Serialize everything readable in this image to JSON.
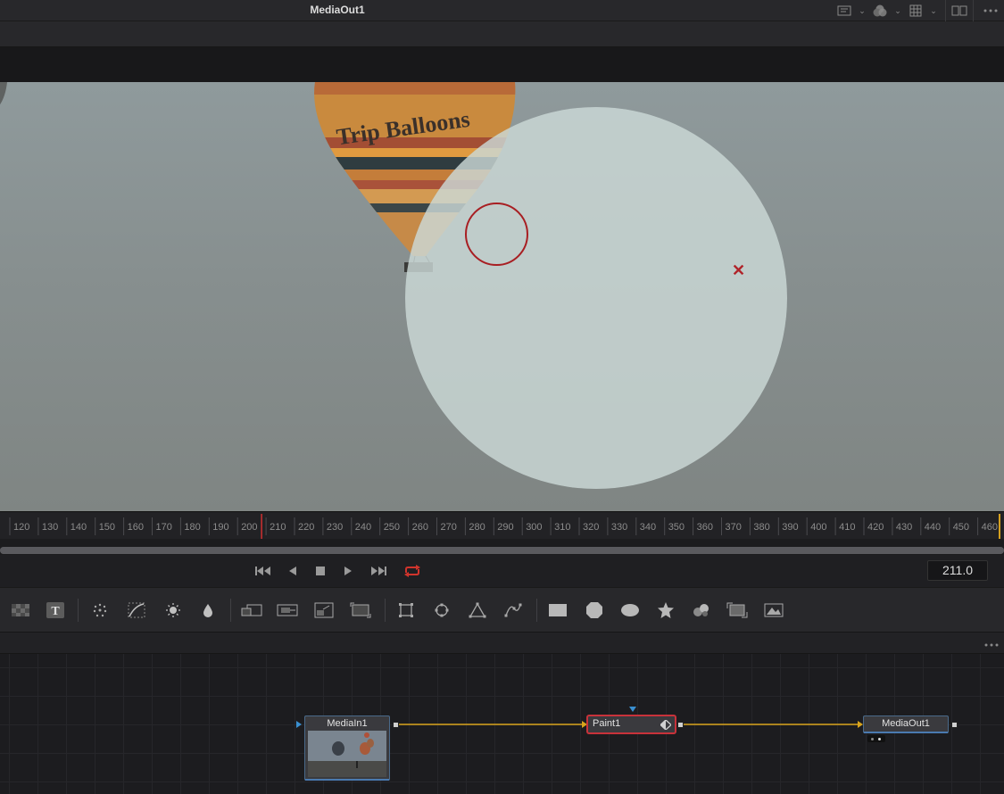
{
  "viewer": {
    "title": "MediaOut1",
    "header_icons": [
      "viewer-lut-icon",
      "color-channel-icon",
      "grid-icon",
      "split-view-icon",
      "more-options-icon"
    ]
  },
  "image": {
    "balloon_text": "Trip Balloons"
  },
  "ruler": {
    "ticks": [
      "120",
      "130",
      "140",
      "150",
      "160",
      "170",
      "180",
      "190",
      "200",
      "210",
      "220",
      "230",
      "240",
      "250",
      "260",
      "270",
      "280",
      "290",
      "300",
      "310",
      "320",
      "330",
      "340",
      "350",
      "360",
      "370",
      "380",
      "390",
      "400",
      "410",
      "420",
      "430",
      "440",
      "450",
      "460"
    ],
    "playhead": "210"
  },
  "transport": {
    "buttons": [
      "go-to-start-icon",
      "play-reverse-icon",
      "stop-icon",
      "play-forward-icon",
      "go-to-end-icon",
      "loop-icon"
    ],
    "timecode": "211.0",
    "progress": 1.0
  },
  "tools": {
    "groups": [
      [
        "background-icon",
        "text-icon"
      ],
      [
        "particles-icon",
        "curves-icon",
        "brightness-contrast-icon",
        "blur-icon"
      ],
      [
        "merge-icon",
        "transform-icon",
        "resize-icon",
        "corner-pin-icon"
      ],
      [
        "rectangle-mask-icon",
        "ellipse-mask-icon",
        "polygon-mask-icon",
        "bspline-mask-icon"
      ],
      [
        "rectangle-icon",
        "polygon-icon",
        "ellipse-icon",
        "star-icon",
        "paint-icon",
        "tracker-icon",
        "planar-tracker-icon"
      ]
    ]
  },
  "nodes": {
    "media_in": "MediaIn1",
    "paint": "Paint1",
    "media_out": "MediaOut1",
    "link_color": "#d8a41c",
    "selected_color": "#c8323a"
  }
}
